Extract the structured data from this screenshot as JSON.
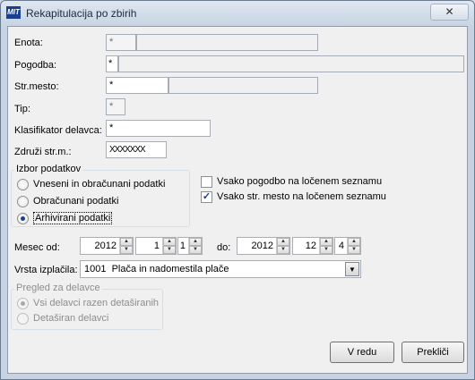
{
  "window": {
    "title": "Rekapitulacija po zbirih",
    "app_icon": "MIT",
    "close_glyph": "✕"
  },
  "enota": {
    "label": "Enota:",
    "code": "*",
    "name": ""
  },
  "pogodba": {
    "label": "Pogodba:",
    "code": "*",
    "name": ""
  },
  "strmesto": {
    "label": "Str.mesto:",
    "code": "*",
    "name": ""
  },
  "tip": {
    "label": "Tip:",
    "value": "*"
  },
  "klasifikator": {
    "label": "Klasifikator delavca:",
    "value": "*"
  },
  "zdruzi": {
    "label": "Združi str.m.:",
    "value": "XXXXXXX"
  },
  "izbor": {
    "title": "Izbor podatkov",
    "options": [
      "Vneseni in obračunani podatki",
      "Obračunani podatki",
      "Arhivirani podatki"
    ],
    "selected_index": 2
  },
  "checks": [
    {
      "label": "Vsako pogodbo na ločenem seznamu",
      "checked": false,
      "mark": ""
    },
    {
      "label": "Vsako str. mesto na ločenem seznamu",
      "checked": true,
      "mark": "✓"
    }
  ],
  "mesec": {
    "od_label": "Mesec od:",
    "od_year": "2012",
    "od_month": "1",
    "od_day": "1",
    "do_label": "do:",
    "do_year": "2012",
    "do_month": "12",
    "do_day": "4",
    "up_arrow": "▲",
    "down_arrow": "▼"
  },
  "vrsta": {
    "label": "Vrsta izplačila:",
    "value": "1001  Plača in nadomestila plače",
    "arrow": "▼"
  },
  "pregled": {
    "title": "Pregled za delavce",
    "options": [
      "Vsi delavci razen detaširanih",
      "Detaširan delavci"
    ],
    "selected_index": 0
  },
  "buttons": {
    "ok": "V redu",
    "cancel": "Prekliči"
  }
}
